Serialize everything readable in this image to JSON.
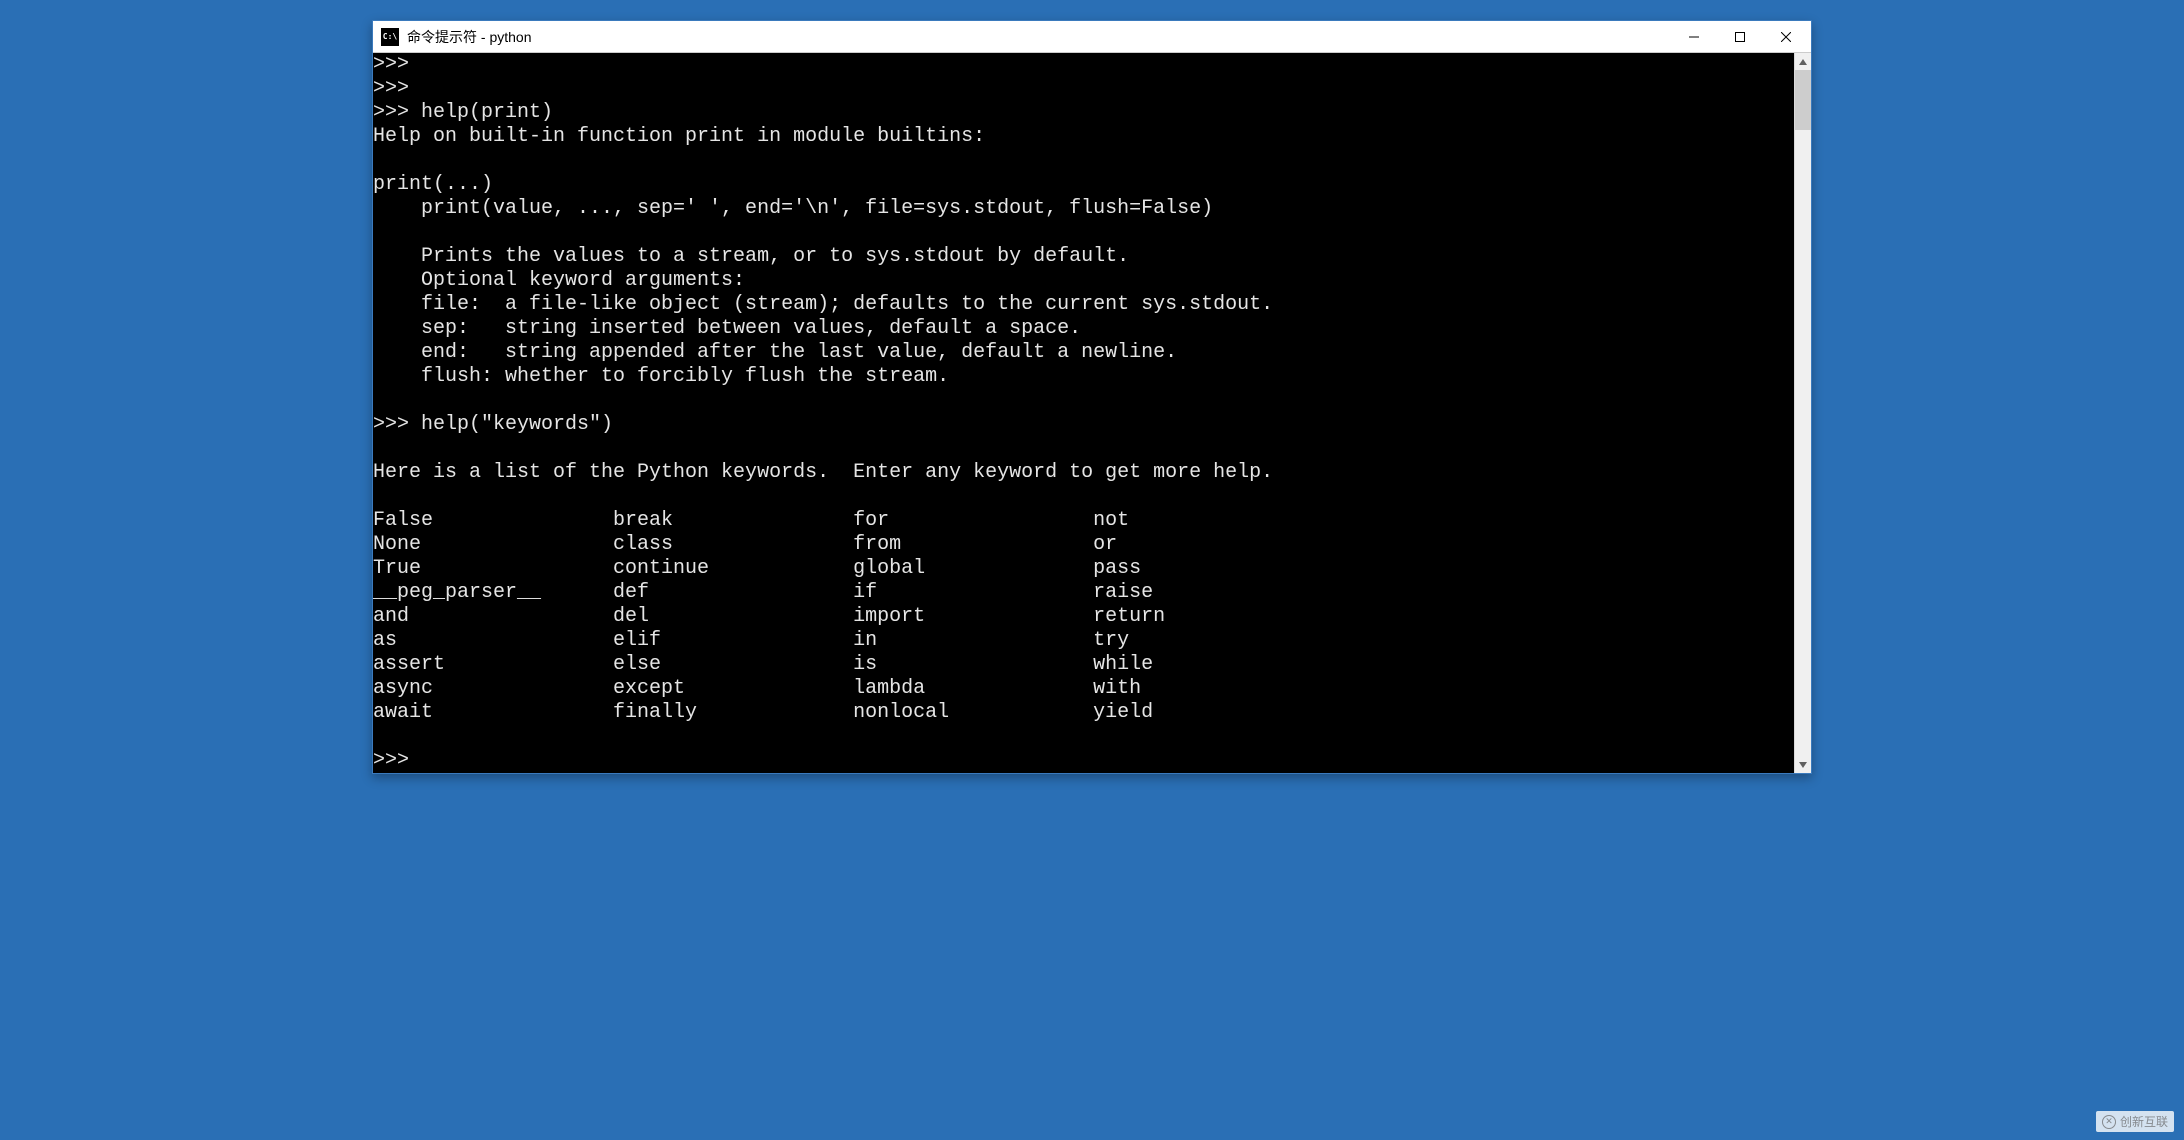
{
  "window": {
    "title": "命令提示符 - python",
    "icon_label": "C:\\"
  },
  "terminal": {
    "lines": [
      ">>>",
      ">>>",
      ">>> help(print)",
      "Help on built-in function print in module builtins:",
      "",
      "print(...)",
      "    print(value, ..., sep=' ', end='\\n', file=sys.stdout, flush=False)",
      "",
      "    Prints the values to a stream, or to sys.stdout by default.",
      "    Optional keyword arguments:",
      "    file:  a file-like object (stream); defaults to the current sys.stdout.",
      "    sep:   string inserted between values, default a space.",
      "    end:   string appended after the last value, default a newline.",
      "    flush: whether to forcibly flush the stream.",
      "",
      ">>> help(\"keywords\")",
      "",
      "Here is a list of the Python keywords.  Enter any keyword to get more help.",
      "",
      "False               break               for                 not",
      "None                class               from                or",
      "True                continue            global              pass",
      "__peg_parser__      def                 if                  raise",
      "and                 del                 import              return",
      "as                  elif                in                  try",
      "assert              else                is                  while",
      "async               except              lambda              with",
      "await               finally             nonlocal            yield",
      "",
      ">>>"
    ]
  },
  "watermark": {
    "text": "创新互联"
  }
}
